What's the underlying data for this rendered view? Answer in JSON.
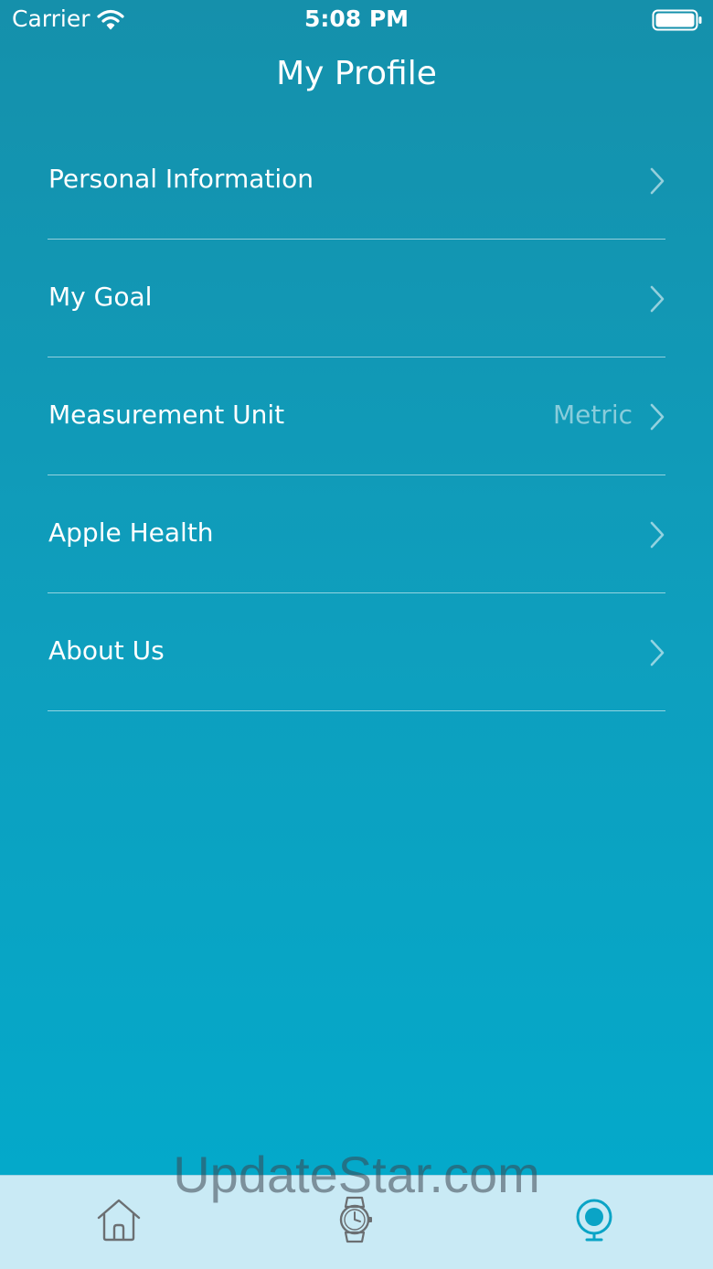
{
  "status_bar": {
    "carrier": "Carrier",
    "time": "5:08 PM",
    "wifi_icon": "wifi-icon",
    "battery_icon": "battery-full-icon"
  },
  "header": {
    "title": "My Profile"
  },
  "menu": {
    "items": [
      {
        "label": "Personal Information",
        "value": ""
      },
      {
        "label": "My Goal",
        "value": ""
      },
      {
        "label": "Measurement Unit",
        "value": "Metric"
      },
      {
        "label": "Apple Health",
        "value": ""
      },
      {
        "label": "About Us",
        "value": ""
      }
    ]
  },
  "tab_bar": {
    "tabs": [
      {
        "icon": "home-icon",
        "active": false
      },
      {
        "icon": "watch-icon",
        "active": false
      },
      {
        "icon": "profile-icon",
        "active": true
      }
    ]
  },
  "watermark": "UpdateStar.com",
  "colors": {
    "gradient_top": "#1590ab",
    "gradient_bottom": "#04a9ca",
    "tab_bar_bg": "#c9eaf5",
    "tab_active": "#0aa4c6",
    "tab_inactive": "#6b6f72"
  }
}
